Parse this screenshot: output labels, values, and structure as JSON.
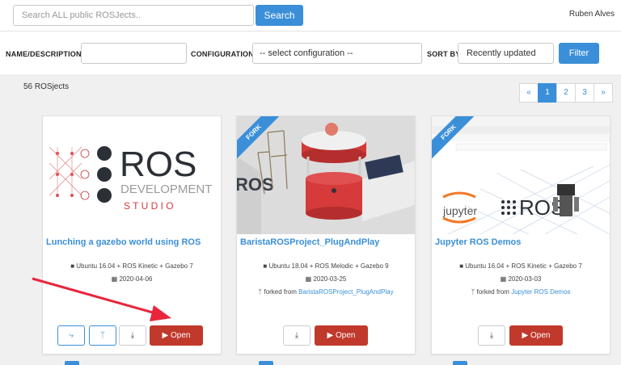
{
  "search": {
    "placeholder": "Search ALL public ROSJects..",
    "button": "Search"
  },
  "user": {
    "name": "Ruben Alves"
  },
  "filters": {
    "name_label": "NAME/DESCRIPTION",
    "config_label": "CONFIGURATION",
    "config_value": "-- select configuration --",
    "sort_label": "SORT BY",
    "sort_value": "Recently updated",
    "filter_button": "Filter"
  },
  "results": {
    "count": "56 ROSjects"
  },
  "pagination": {
    "prev": "«",
    "pages": [
      "1",
      "2",
      "3"
    ],
    "next": "»",
    "active": "1"
  },
  "logo": {
    "ros": "ROS",
    "development": "DEVELOPMENT",
    "studio": "S T U D I O"
  },
  "jupyter_logo": "jupyter",
  "ros_small_logo": "ROS",
  "cards": [
    {
      "title": "Lunching a gazebo world using ROS",
      "config": "Ubuntu 16.04 + ROS Kinetic + Gazebo 7",
      "date": "2020-04-06",
      "open": "Open"
    },
    {
      "ribbon": "FORK",
      "title": "BaristaROSProject_PlugAndPlay",
      "config": "Ubuntu 18.04 + ROS Melodic + Gazebo 9",
      "date": "2020-03-25",
      "forked_prefix": "forked from",
      "forked_from": "BaristaROSProject_PlugAndPlay",
      "open": "Open"
    },
    {
      "ribbon": "FORK",
      "title": "Jupyter ROS Demos",
      "config": "Ubuntu 16.04 + ROS Kinetic + Gazebo 7",
      "date": "2020-03-03",
      "forked_prefix": "forked from",
      "forked_from": "Jupyter ROS Demos",
      "open": "Open"
    }
  ],
  "colors": {
    "accent": "#3a8fd8",
    "open_button": "#c0392b",
    "arrow": "#e8253d",
    "background": "#f0f0f0"
  }
}
